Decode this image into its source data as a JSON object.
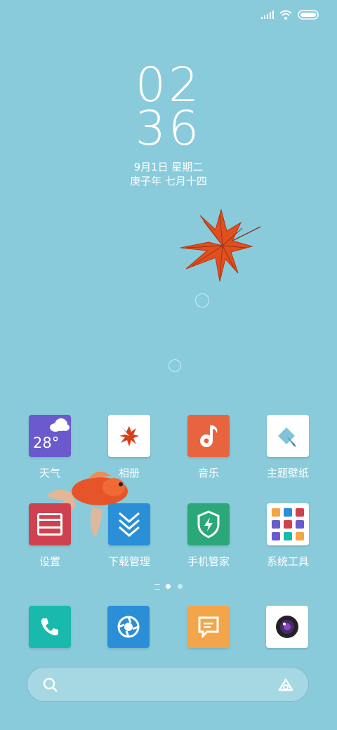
{
  "status_bar": {
    "icons": [
      "signal-icon",
      "wifi-icon",
      "battery-icon"
    ]
  },
  "lock_clock": {
    "hour": "02",
    "minute": "36"
  },
  "date": {
    "solar": "9月1日 星期二",
    "lunar": "庚子年 七月十四"
  },
  "weather_widget": {
    "temperature": "28°"
  },
  "apps_row1": [
    {
      "label": "天气"
    },
    {
      "label": "相册"
    },
    {
      "label": "音乐"
    },
    {
      "label": "主题壁纸"
    }
  ],
  "apps_row2": [
    {
      "label": "设置"
    },
    {
      "label": "下载管理"
    },
    {
      "label": "手机管家"
    },
    {
      "label": "系统工具"
    }
  ],
  "page_indicator": {
    "pages": 2,
    "current": 1
  },
  "dock": [
    "phone-icon",
    "browser-icon",
    "messages-icon",
    "camera-icon"
  ],
  "colors": {
    "wallpaper": "#89cbdb",
    "weather": "#6a5acd",
    "music": "#e8643f",
    "settings": "#d0414f",
    "downloads": "#2a8fd6",
    "security": "#2aa877",
    "phone": "#19b9ad",
    "browser": "#2a8fd6",
    "messages": "#f3a54a"
  }
}
